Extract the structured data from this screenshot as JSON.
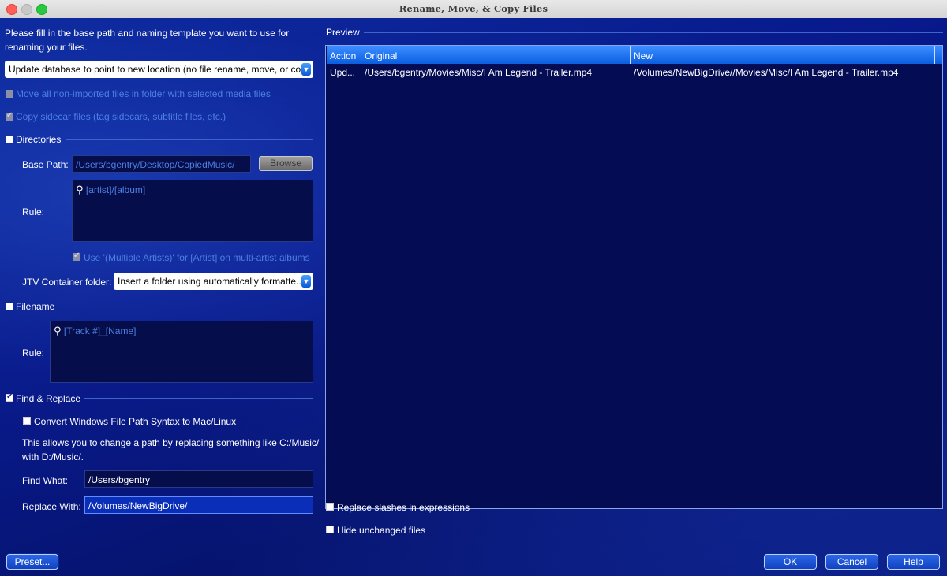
{
  "window": {
    "title": "Rename, Move, & Copy Files"
  },
  "intro": {
    "line1": "Please fill in the base path and naming template you want to use for",
    "line2": "renaming your files."
  },
  "mode_select": {
    "value": "Update database to point to new location (no file rename, move, or co..."
  },
  "options": {
    "move_non_imported": "Move all non-imported files in folder with selected media files",
    "copy_sidecar": "Copy sidecar files (tag sidecars, subtitle files, etc.)"
  },
  "directories": {
    "section_label": "Directories",
    "base_path_label": "Base Path:",
    "base_path_value": "/Users/bgentry/Desktop/CopiedMusic/",
    "browse_label": "Browse",
    "rule_label": "Rule:",
    "rule_value": "[artist]/[album]",
    "multiple_artists_label": "Use '(Multiple Artists)' for [Artist] on multi-artist albums",
    "jtv_label": "JTV Container folder:",
    "jtv_value": "Insert a folder using automatically formatte..."
  },
  "filename": {
    "section_label": "Filename",
    "rule_label": "Rule:",
    "rule_value": "[Track #]_[Name]"
  },
  "find_replace": {
    "section_label": "Find & Replace",
    "convert_label": "Convert Windows File Path Syntax to Mac/Linux",
    "help_line1": "This allows you to change a path by replacing something like C:/Music/",
    "help_line2": "with D:/Music/.",
    "find_label": "Find What:",
    "find_value": "/Users/bgentry",
    "replace_label": "Replace With:",
    "replace_value": "/Volumes/NewBigDrive/"
  },
  "preview": {
    "section_label": "Preview",
    "columns": [
      "Action",
      "Original",
      "New"
    ],
    "rows": [
      {
        "action": "Upd...",
        "original": "/Users/bgentry/Movies/Misc/I Am Legend - Trailer.mp4",
        "new": "/Volumes/NewBigDrive//Movies/Misc/I Am Legend - Trailer.mp4"
      }
    ],
    "replace_slashes_label": "Replace slashes in expressions",
    "hide_unchanged_label": "Hide unchanged files"
  },
  "buttons": {
    "preset": "Preset...",
    "ok": "OK",
    "cancel": "Cancel",
    "help": "Help"
  },
  "icons": {
    "search": "search-icon",
    "dropdown": "dropdown-arrow-icon"
  },
  "colors": {
    "background": "#0a1a66",
    "accent": "#0b5fe0",
    "disabled_text": "#4d7fe0"
  }
}
